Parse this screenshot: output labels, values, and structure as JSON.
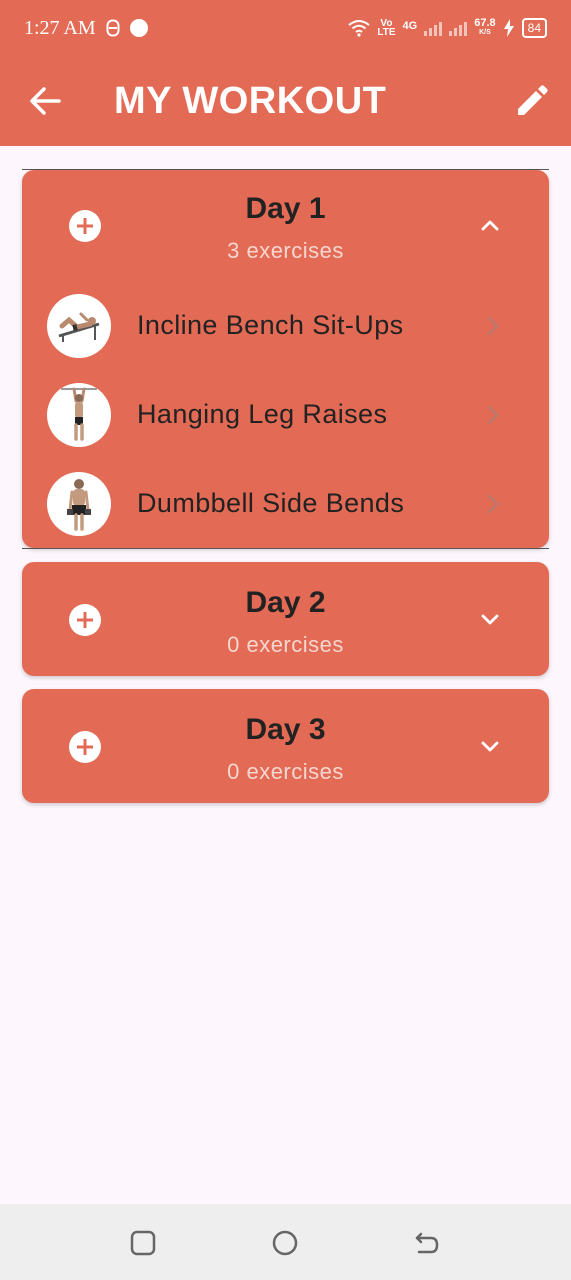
{
  "status_bar": {
    "time": "1:27 AM",
    "network_speed": "67.8",
    "network_unit": "K/S",
    "volte_top": "Vo",
    "volte_bottom": "LTE",
    "network_type": "4G",
    "battery": "84"
  },
  "app_bar": {
    "title": "MY WORKOUT",
    "back_icon": "arrow-left-icon",
    "edit_icon": "pencil-icon"
  },
  "days": [
    {
      "title": "Day 1",
      "count": "3 exercises",
      "expanded": true,
      "exercises": [
        {
          "name": "Incline Bench Sit-Ups"
        },
        {
          "name": "Hanging Leg Raises"
        },
        {
          "name": "Dumbbell Side Bends"
        }
      ]
    },
    {
      "title": "Day 2",
      "count": "0 exercises",
      "expanded": false,
      "exercises": []
    },
    {
      "title": "Day 3",
      "count": "0 exercises",
      "expanded": false,
      "exercises": []
    }
  ],
  "colors": {
    "accent": "#e36b55",
    "background": "#fdf6fd",
    "nav_bar": "#eeeeee"
  },
  "nav_bar": {
    "recent_icon": "square-icon",
    "home_icon": "circle-icon",
    "back_icon": "back-arrow-icon"
  }
}
